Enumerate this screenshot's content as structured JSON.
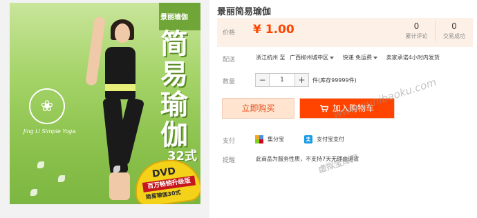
{
  "product": {
    "title": "景丽简易瑜伽",
    "image": {
      "series_logo": "景丽瑜伽",
      "cover_title": "简易瑜伽",
      "cover_title_suffix": "32式",
      "english_title": "Jing Li Simple Yoga",
      "badge_format": "DVD",
      "badge_line1": "百万畅销升级版",
      "badge_line2": "简易瑜伽30式"
    }
  },
  "price": {
    "label": "价格",
    "value": "¥ 1.00",
    "reviews_count": "0",
    "reviews_label": "累计评论",
    "sales_count": "0",
    "sales_label": "交易成功"
  },
  "shipping": {
    "label": "配送",
    "origin": "浙江杭州 至",
    "destination": "广西柳州城中区",
    "method": "快递 免运费",
    "promise": "卖家承诺4小时内发货"
  },
  "quantity": {
    "label": "数量",
    "minus": "−",
    "value": "1",
    "plus": "+",
    "stock": "件(库存99999件)"
  },
  "actions": {
    "buy_now": "立即购买",
    "add_to_cart": "加入购物车"
  },
  "payment": {
    "label": "支付",
    "method1": "集分宝",
    "method2": "支付宝支付"
  },
  "notice": {
    "label": "提醒",
    "text": "此商品为服务性质，不支持7天无理由退货"
  },
  "watermark": {
    "url": "www.xunibaoku.com",
    "text": "虚拟宝库网"
  },
  "colors": {
    "price": "#ff4400",
    "cart_button": "#ff4400",
    "buy_button_bg": "#ffe4d0",
    "price_panel_bg": "#fdf1e7"
  }
}
